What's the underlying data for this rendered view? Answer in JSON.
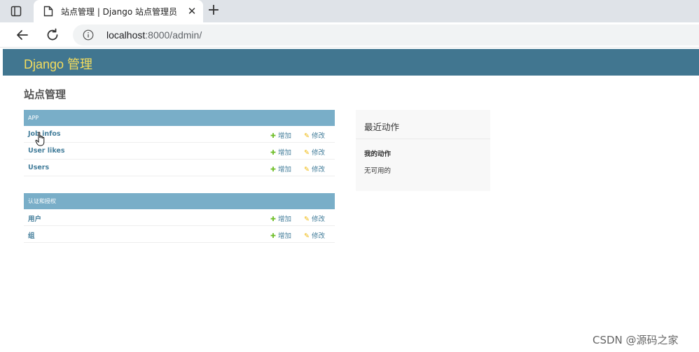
{
  "browser": {
    "tab_title": "站点管理 | Django 站点管理员",
    "tab_close": "✕",
    "new_tab": "+",
    "url_host": "localhost",
    "url_rest": ":8000/admin/"
  },
  "header": {
    "brand": "Django 管理"
  },
  "page": {
    "title": "站点管理"
  },
  "modules": [
    {
      "caption": "APP",
      "models": [
        {
          "name": "Job infos",
          "add": "增加",
          "change": "修改"
        },
        {
          "name": "User likes",
          "add": "增加",
          "change": "修改"
        },
        {
          "name": "Users",
          "add": "增加",
          "change": "修改"
        }
      ]
    },
    {
      "caption": "认证和授权",
      "models": [
        {
          "name": "用户",
          "add": "增加",
          "change": "修改"
        },
        {
          "name": "组",
          "add": "增加",
          "change": "修改"
        }
      ]
    }
  ],
  "recent_actions": {
    "title": "最近动作",
    "my_actions": "我的动作",
    "none": "无可用的"
  },
  "watermark": "CSDN @源码之家",
  "colors": {
    "header_bg": "#417690",
    "brand": "#f5dd5d",
    "caption_bg": "#79aec8",
    "link": "#447e9b",
    "add_icon": "#70bf2b",
    "change_icon": "#efb80b"
  }
}
